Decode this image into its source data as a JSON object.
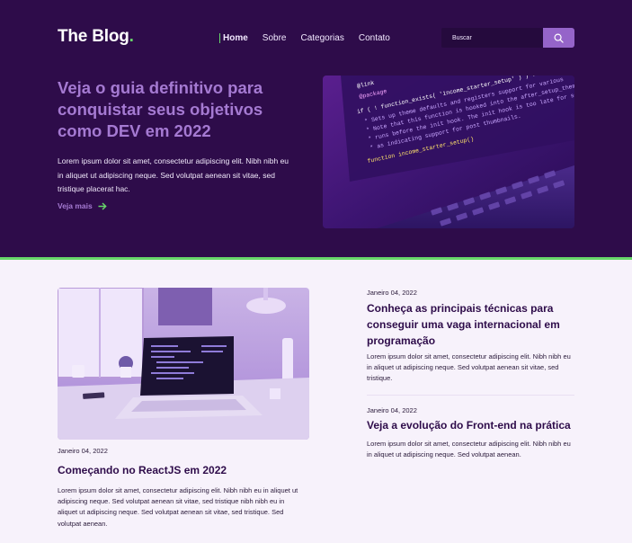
{
  "header": {
    "logo_text": "The Blog",
    "logo_dot": ".",
    "nav": [
      {
        "label": "Home",
        "active": true
      },
      {
        "label": "Sobre",
        "active": false
      },
      {
        "label": "Categorias",
        "active": false
      },
      {
        "label": "Contato",
        "active": false
      }
    ],
    "search": {
      "placeholder": "Buscar",
      "button_icon": "search-icon"
    }
  },
  "hero": {
    "title": "Veja o guia definitivo para conquistar seus objetivos como DEV em 2022",
    "text": "Lorem ipsum dolor sit amet, consectetur adipiscing elit. Nibh nibh eu in aliquet ut adipiscing neque. Sed volutpat aenean sit vitae, sed tristique placerat hac.",
    "link_label": "Veja mais",
    "link_icon": "arrow-right-icon",
    "image_code_lines": [
      "@link",
      "@package",
      "if ( ! function_exists( 'income_starter_setup' ) ) :",
      "* Sets up theme defaults and registers support for various",
      "* Note that this function is hooked into the after_setup_theme",
      "* runs before the init hook. The init hook is too late for some",
      "* as indicating support for post thumbnails.",
      "function income_starter_setup()"
    ]
  },
  "posts": {
    "featured": {
      "date": "Janeiro 04, 2022",
      "title": "Começando no ReactJS em 2022",
      "excerpt": "Lorem ipsum dolor sit amet, consectetur adipiscing elit. Nibh nibh eu in aliquet ut adipiscing neque. Sed volutpat aenean sit vitae, sed tristique nibh nibh eu in aliquet ut adipiscing neque. Sed volutpat aenean sit vitae, sed tristique. Sed volutpat aenean."
    },
    "side": [
      {
        "date": "Janeiro 04, 2022",
        "title": "Conheça as principais técnicas para conseguir uma vaga internacional em programação",
        "excerpt": "Lorem ipsum dolor sit amet, consectetur adipiscing elit. Nibh nibh eu in aliquet ut adipiscing neque. Sed volutpat aenean sit vitae, sed tristique."
      },
      {
        "date": "Janeiro 04, 2022",
        "title": "Veja a evolução do Front-end na prática",
        "excerpt": "Lorem ipsum dolor sit amet, consectetur adipiscing elit. Nibh nibh eu in aliquet ut adipiscing neque. Sed volutpat aenean."
      }
    ]
  },
  "colors": {
    "hero_bg": "#2e0c4a",
    "accent_purple": "#a57ad2",
    "accent_green": "#67d66a",
    "page_bg": "#f7f2fb",
    "title_dark": "#2e0c4a"
  }
}
